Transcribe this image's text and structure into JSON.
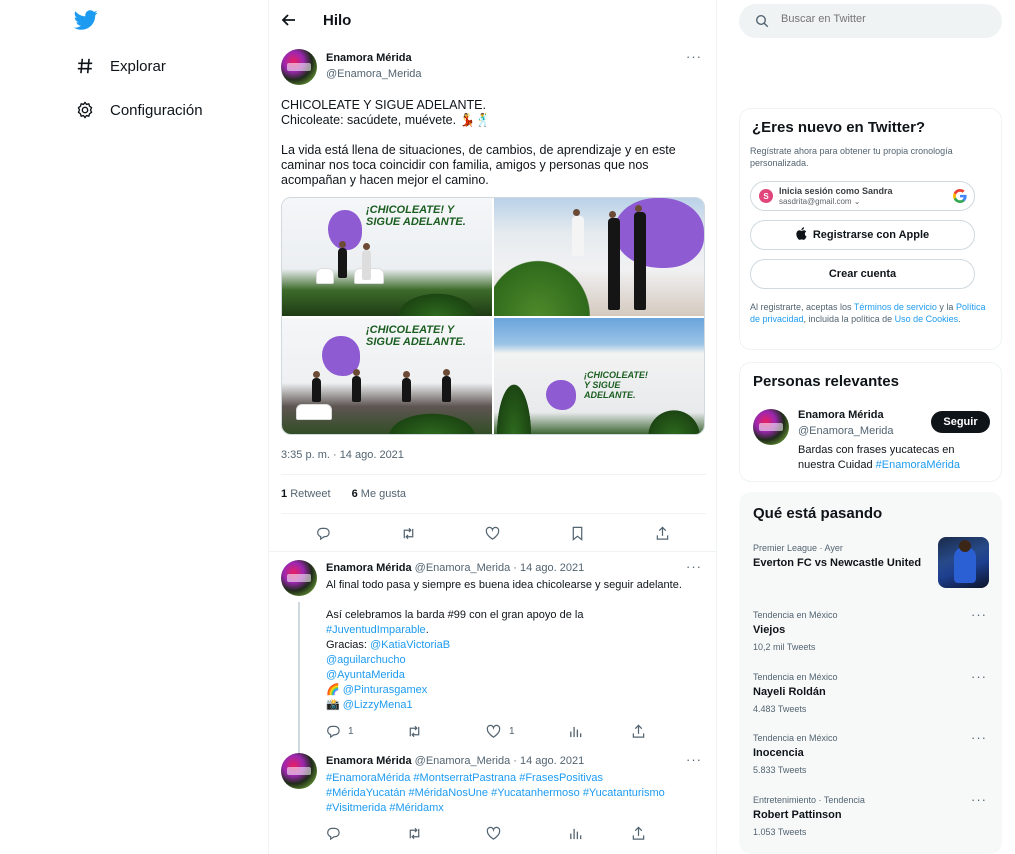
{
  "nav": {
    "items": [
      {
        "label": "Explorar",
        "icon": "hashtag-icon"
      },
      {
        "label": "Configuración",
        "icon": "gear-icon"
      }
    ]
  },
  "header": {
    "title": "Hilo"
  },
  "main_tweet": {
    "name": "Enamora Mérida",
    "handle": "@Enamora_Merida",
    "line1": "CHICOLEATE Y SIGUE ADELANTE.",
    "line2": "Chicoleate: sacúdete, muévete. 💃🕺",
    "paragraph": "La vida está llena de situaciones, de cambios, de aprendizaje y en este caminar nos toca coincidir con familia, amigos y personas que nos acompañan y hacen mejor el camino.",
    "photo_text_1": "¡CHICOLEATE! Y SIGUE ADELANTE.",
    "photo_text_2": "¡CHICOLEATE! Y SIGUE ADELANTE.",
    "photo_text_3": "¡CHICOLEATE! Y SIGUE ADELANTE.",
    "timestamp": "3:35 p. m. · 14 ago. 2021",
    "retweets_count": "1",
    "retweets_label": "Retweet",
    "likes_count": "6",
    "likes_label": "Me gusta"
  },
  "replies": [
    {
      "name": "Enamora Mérida",
      "meta": "@Enamora_Merida · 14 ago. 2021",
      "text1": "Al final todo pasa y siempre es buena idea chicolearse y seguir adelante.",
      "text2": "Así celebramos la barda #99 con el gran apoyo de la",
      "hashtag": "#JuventudImparable",
      "dot": ".",
      "gracias": "Gracias: ",
      "mention1": "@KatiaVictoriaB",
      "mention2": "@aguilarchucho",
      "mention3": "@AyuntaMerida",
      "emoji1": "🌈 ",
      "mention4": "@Pinturasgamex",
      "emoji2": "📸 ",
      "mention5": "@LizzyMena1",
      "reply_count": "1",
      "like_count": "1"
    },
    {
      "name": "Enamora Mérida",
      "meta": "@Enamora_Merida · 14 ago. 2021",
      "hashtags_line1": "#EnamoraMérida #MontserratPastrana #FrasesPositivas",
      "hashtags_line2": "#MéridaYucatán #MéridaNosUne #Yucatanhermoso #Yucatanturismo",
      "hashtags_line3": "#Visitmerida #Méridamx"
    }
  ],
  "search": {
    "placeholder": "Buscar en Twitter"
  },
  "new_to_twitter": {
    "title": "¿Eres nuevo en Twitter?",
    "subtitle": "Regístrate ahora para obtener tu propia cronología personalizada.",
    "google_avatar_letter": "S",
    "google_line1": "Inicia sesión como Sandra",
    "google_line2": "sasdrita@gmail.com ⌄",
    "apple_label": "Registrarse con Apple",
    "create_label": "Crear cuenta",
    "legal_pre": "Al registrarte, aceptas los ",
    "legal_terms": "Términos de servicio",
    "legal_mid": " y la ",
    "legal_privacy": "Política de privacidad",
    "legal_mid2": ", incluida la política de ",
    "legal_cookies": "Uso de Cookies",
    "legal_end": "."
  },
  "relevant": {
    "title": "Personas relevantes",
    "name": "Enamora Mérida",
    "handle": "@Enamora_Merida",
    "bio": "Bardas con frases yucatecas en nuestra Cuidad ",
    "bio_hashtag": "#EnamoraMérida",
    "follow_label": "Seguir"
  },
  "trends": {
    "title": "Qué está pasando",
    "items": [
      {
        "context": "Premier League · Ayer",
        "title": "Everton FC vs Newcastle United",
        "count": ""
      },
      {
        "context": "Tendencia en México",
        "title": "Viejos",
        "count": "10,2 mil Tweets"
      },
      {
        "context": "Tendencia en México",
        "title": "Nayeli Roldán",
        "count": "4.483 Tweets"
      },
      {
        "context": "Tendencia en México",
        "title": "Inocencia",
        "count": "5.833 Tweets"
      },
      {
        "context": "Entretenimiento · Tendencia",
        "title": "Robert Pattinson",
        "count": "1.053 Tweets"
      }
    ]
  },
  "colors": {
    "accent": "#1d9bf0",
    "text": "#0f1419",
    "muted": "#536471",
    "border": "#eff3f4"
  }
}
